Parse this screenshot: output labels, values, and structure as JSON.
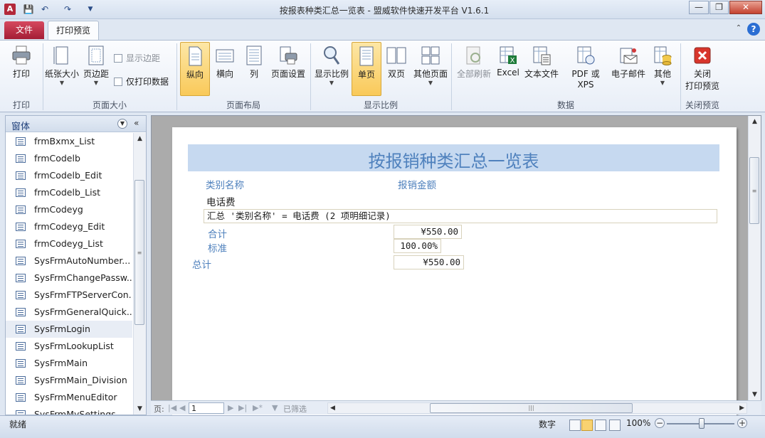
{
  "window": {
    "title": "按报表种类汇总一览表 - 盟威软件快速开发平台 V1.6.1",
    "app_icon_letter": "A"
  },
  "ribbon_tabs": [
    {
      "label": "文件",
      "active": false
    },
    {
      "label": "打印预览",
      "active": true
    }
  ],
  "ribbon": {
    "groups": [
      {
        "label": "打印",
        "buttons": [
          {
            "label": "打印",
            "icon": "printer-icon"
          }
        ]
      },
      {
        "label": "页面大小",
        "buttons": [
          {
            "label": "纸张大小",
            "icon": "paper-size-icon"
          },
          {
            "label": "页边距",
            "icon": "margins-icon"
          }
        ],
        "checkboxes": [
          {
            "label": "显示边距",
            "checked": false,
            "disabled": true
          },
          {
            "label": "仅打印数据",
            "checked": false,
            "disabled": false
          }
        ]
      },
      {
        "label": "页面布局",
        "buttons": [
          {
            "label": "纵向",
            "icon": "portrait-icon",
            "active": true
          },
          {
            "label": "横向",
            "icon": "landscape-icon"
          },
          {
            "label": "列",
            "icon": "columns-icon"
          },
          {
            "label": "页面设置",
            "icon": "page-setup-icon"
          }
        ]
      },
      {
        "label": "显示比例",
        "buttons": [
          {
            "label": "显示比例",
            "icon": "zoom-magnifier-icon"
          },
          {
            "label": "单页",
            "icon": "one-page-icon",
            "active": true
          },
          {
            "label": "双页",
            "icon": "two-pages-icon"
          },
          {
            "label": "其他页面",
            "icon": "more-pages-icon"
          }
        ]
      },
      {
        "label": "数据",
        "buttons": [
          {
            "label": "全部刷新",
            "icon": "refresh-icon",
            "disabled": true
          },
          {
            "label": "Excel",
            "icon": "excel-icon"
          },
          {
            "label": "文本文件",
            "icon": "text-file-icon"
          },
          {
            "label": "PDF 或 XPS",
            "icon": "pdf-icon"
          },
          {
            "label": "电子邮件",
            "icon": "email-icon"
          },
          {
            "label": "其他",
            "icon": "more-export-icon"
          }
        ]
      },
      {
        "label": "关闭预览",
        "buttons": [
          {
            "label_line1": "关闭",
            "label_line2": "打印预览",
            "icon": "close-preview-icon"
          }
        ]
      }
    ]
  },
  "nav_pane": {
    "title": "窗体",
    "items": [
      "frmBxmx_List",
      "frmCodelb",
      "frmCodelb_Edit",
      "frmCodelb_List",
      "frmCodeyg",
      "frmCodeyg_Edit",
      "frmCodeyg_List",
      "SysFrmAutoNumber...",
      "SysFrmChangePassw...",
      "SysFrmFTPServerCon...",
      "SysFrmGeneralQuick...",
      "SysFrmLogin",
      "SysFrmLookupList",
      "SysFrmMain",
      "SysFrmMain_Division",
      "SysFrmMenuEditor",
      "SysFrmMySettings"
    ],
    "selected_index": 11
  },
  "report": {
    "title": "按报销种类汇总一览表",
    "col_category": "类别名称",
    "col_amount": "报销金额",
    "category_value": "电话费",
    "summary_line": "汇总 '类别名称' = 电话费 (2 项明细记录)",
    "subtotal_label": "合计",
    "subtotal_value": "¥550.00",
    "percent_label": "标准",
    "percent_value": "100.00%",
    "total_label": "总计",
    "total_value": "¥550.00"
  },
  "record_nav": {
    "page_label": "页:",
    "page_value": "1",
    "filter_label": "已筛选"
  },
  "status_bar": {
    "left_text": "就绪",
    "mode_text": "数字",
    "zoom_text": "100%"
  }
}
